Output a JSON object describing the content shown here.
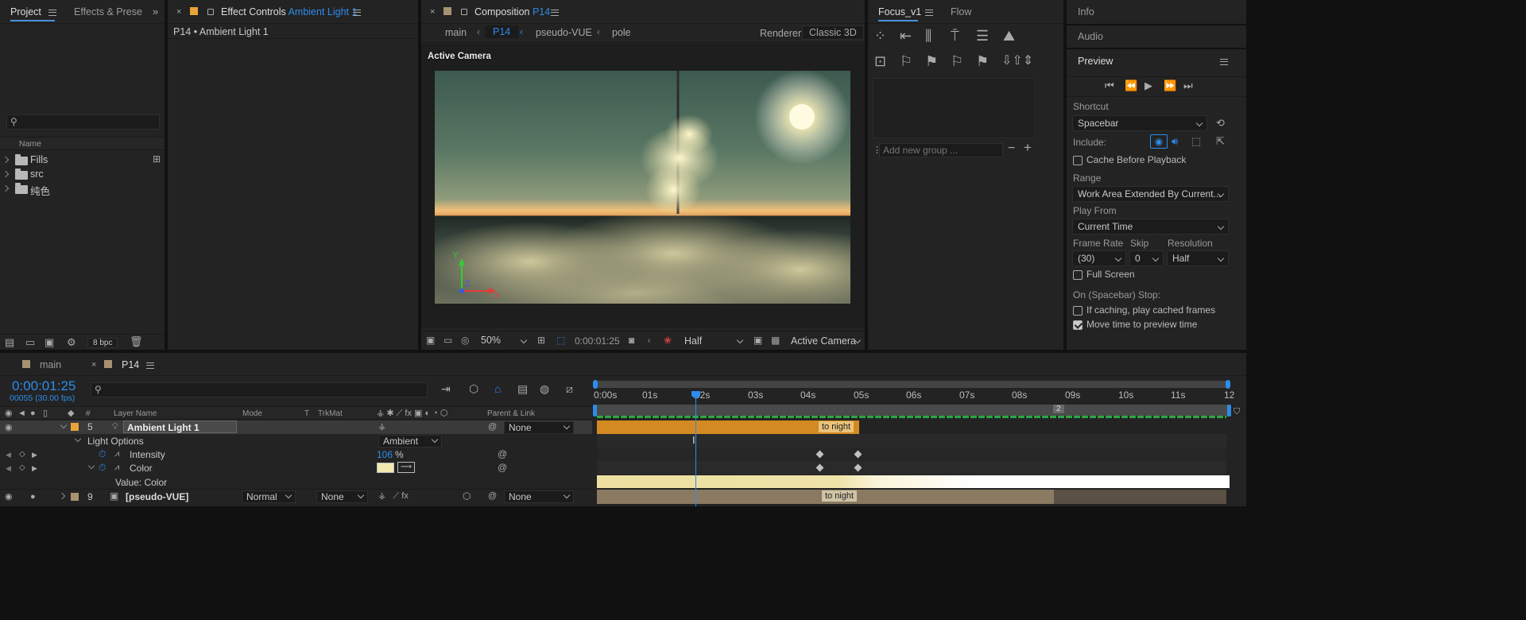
{
  "project": {
    "tab_project": "Project",
    "tab_effects": "Effects & Prese",
    "search_placeholder": "",
    "col_name": "Name",
    "items": [
      "Fills",
      "src",
      "纯色"
    ],
    "bpc": "8 bpc"
  },
  "effect_controls": {
    "tab_label": "Effect Controls",
    "tab_target": "Ambient Light 1",
    "subtitle": "P14 • Ambient Light 1"
  },
  "composition": {
    "tab_label": "Composition",
    "tab_name": "P14",
    "breadcrumbs": [
      "main",
      "P14",
      "pseudo-VUE",
      "pole"
    ],
    "renderer_label": "Renderer:",
    "renderer_value": "Classic 3D",
    "view_label": "Active Camera",
    "zoom": "50%",
    "timecode": "0:00:01:25",
    "resolution": "Half",
    "camera": "Active Camera",
    "axis_x": "X",
    "axis_y": "Y",
    "axis_z": "Z"
  },
  "focus": {
    "tab_focus": "Focus_v1",
    "tab_flow": "Flow",
    "add_group_placeholder": "Add new group ..."
  },
  "right": {
    "info": "Info",
    "audio": "Audio",
    "preview": "Preview",
    "shortcut_label": "Shortcut",
    "shortcut_value": "Spacebar",
    "include_label": "Include:",
    "cache_before": "Cache Before Playback",
    "range_label": "Range",
    "range_value": "Work Area Extended By Current...",
    "play_from_label": "Play From",
    "play_from_value": "Current Time",
    "frame_rate_label": "Frame Rate",
    "skip_label": "Skip",
    "resolution_label": "Resolution",
    "frame_rate_value": "(30)",
    "skip_value": "0",
    "resolution_value": "Half",
    "full_screen": "Full Screen",
    "on_stop": "On (Spacebar) Stop:",
    "if_caching": "If caching, play cached frames",
    "move_time": "Move time to preview time",
    "full_screen_checked": false,
    "if_caching_checked": false,
    "move_time_checked": true,
    "cache_before_checked": false
  },
  "timeline": {
    "tab_main": "main",
    "tab_p14": "P14",
    "timecode": "0:00:01:25",
    "frames": "00055 (30.00 fps)",
    "col_layer_name": "Layer Name",
    "col_mode": "Mode",
    "col_t": "T",
    "col_trkmat": "TrkMat",
    "col_parent": "Parent & Link",
    "col_hash": "#",
    "ruler": [
      "0:00s",
      "01s",
      "02s",
      "03s",
      "04s",
      "05s",
      "06s",
      "07s",
      "08s",
      "09s",
      "10s",
      "11s",
      "12"
    ],
    "marker_label": "2",
    "layers": [
      {
        "num": "5",
        "name": "Ambient Light 1",
        "parent": "None",
        "bar_label": "to night"
      },
      {
        "num": "9",
        "name": "[pseudo-VUE]",
        "mode": "Normal",
        "trkmat": "None",
        "parent": "None",
        "bar_label": "to night"
      }
    ],
    "light_options": "Light Options",
    "light_type": "Ambient",
    "intensity_label": "Intensity",
    "intensity_value": "106",
    "intensity_unit": "%",
    "color_label": "Color",
    "value_color": "Value: Color"
  },
  "colors": {
    "accent": "#2d8ceb",
    "layer_orange": "#e8a33a",
    "layer_tan": "#a89272"
  }
}
